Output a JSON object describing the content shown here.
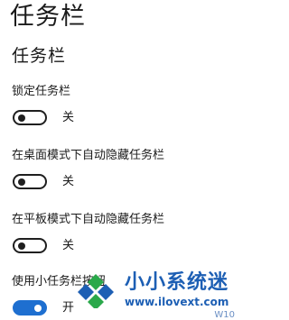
{
  "page": {
    "title": "任务栏"
  },
  "section": {
    "title": "任务栏"
  },
  "settings": [
    {
      "label": "锁定任务栏",
      "state": "关",
      "on": false
    },
    {
      "label": "在桌面模式下自动隐藏任务栏",
      "state": "关",
      "on": false
    },
    {
      "label": "在平板模式下自动隐藏任务栏",
      "state": "关",
      "on": false
    },
    {
      "label": "使用小任务栏按钮",
      "state": "开",
      "on": true
    }
  ],
  "watermark": {
    "title": "小小系统迷",
    "url": "www.ilovext.com",
    "corner_text": "W10"
  },
  "colors": {
    "accent": "#1e6fd0",
    "watermark_blue": "#1d5fb4",
    "watermark_green": "#2aa84a"
  }
}
